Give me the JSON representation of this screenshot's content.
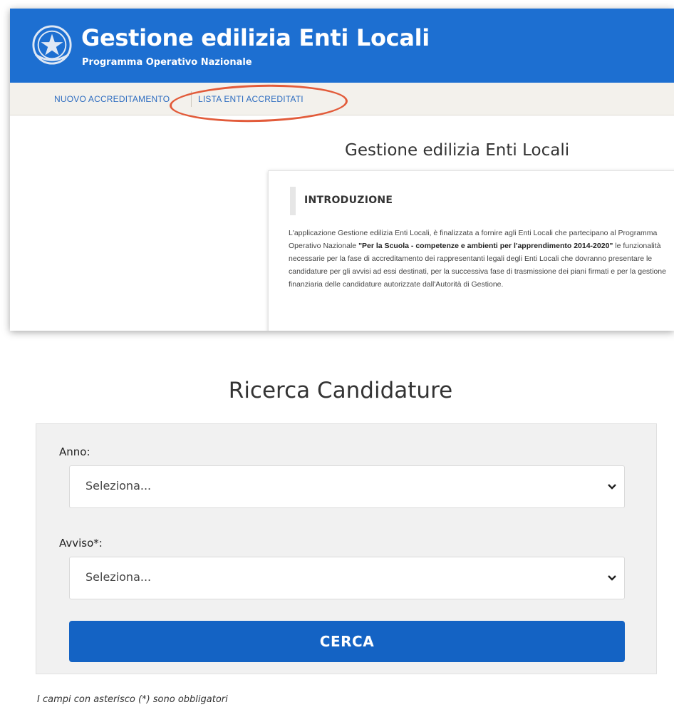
{
  "header": {
    "title": "Gestione edilizia Enti Locali",
    "subtitle": "Programma Operativo Nazionale",
    "emblem_icon": "italian-republic-emblem-icon"
  },
  "nav": {
    "items": [
      {
        "label": "NUOVO ACCREDITAMENTO"
      },
      {
        "label": "LISTA ENTI ACCREDITATI"
      }
    ],
    "highlight_color": "#e25b3a"
  },
  "main": {
    "heading": "Gestione edilizia Enti Locali",
    "intro": {
      "title": "INTRODUZIONE",
      "text_before": "L'applicazione Gestione edilizia Enti Locali, è finalizzata a fornire agli Enti Locali che partecipano al Programma Operativo Nazionale ",
      "text_bold": "\"Per la Scuola - competenze e ambienti per l'apprendimento 2014-2020\"",
      "text_after": " le funzionalità necessarie per la fase di accreditamento dei rappresentanti legali degli Enti Locali che dovranno presentare le candidature per gli avvisi ad essi destinati, per la successiva fase di trasmissione dei piani firmati e per la gestione finanziaria delle candidature autorizzate dall'Autorità di Gestione."
    }
  },
  "search": {
    "title": "Ricerca Candidature",
    "anno_label": "Anno:",
    "anno_value": "Seleziona...",
    "avviso_label": "Avviso*:",
    "avviso_value": "Seleziona...",
    "button_label": "CERCA",
    "footnote": "I campi con asterisco (*) sono obbligatori"
  },
  "colors": {
    "header_blue": "#1d6fd1",
    "button_blue": "#1463c4",
    "link_blue": "#2d6cc0"
  }
}
